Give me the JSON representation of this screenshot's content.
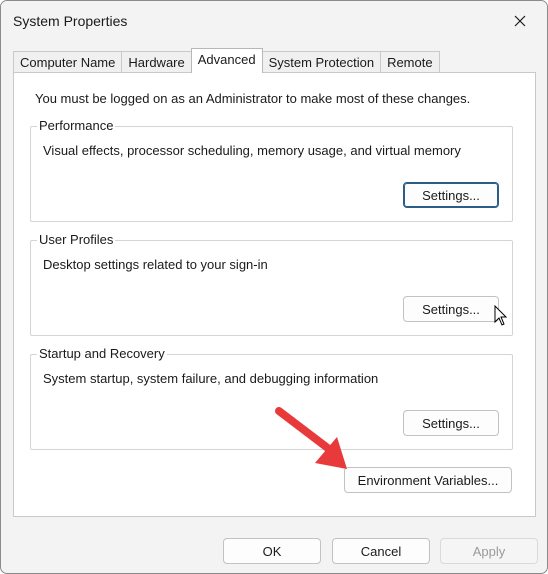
{
  "window": {
    "title": "System Properties",
    "close_icon": "close-icon"
  },
  "tabs": [
    {
      "label": "Computer Name",
      "active": false
    },
    {
      "label": "Hardware",
      "active": false
    },
    {
      "label": "Advanced",
      "active": true
    },
    {
      "label": "System Protection",
      "active": false
    },
    {
      "label": "Remote",
      "active": false
    }
  ],
  "advanced": {
    "notice": "You must be logged on as an Administrator to make most of these changes.",
    "performance": {
      "legend": "Performance",
      "description": "Visual effects, processor scheduling, memory usage, and virtual memory",
      "settings_label": "Settings..."
    },
    "user_profiles": {
      "legend": "User Profiles",
      "description": "Desktop settings related to your sign-in",
      "settings_label": "Settings..."
    },
    "startup_recovery": {
      "legend": "Startup and Recovery",
      "description": "System startup, system failure, and debugging information",
      "settings_label": "Settings..."
    },
    "env_vars_label": "Environment Variables..."
  },
  "footer": {
    "ok_label": "OK",
    "cancel_label": "Cancel",
    "apply_label": "Apply"
  },
  "annotation": {
    "arrow_color": "#e8393b",
    "arrow_icon": "red-arrow-icon",
    "cursor_icon": "mouse-pointer-icon"
  }
}
